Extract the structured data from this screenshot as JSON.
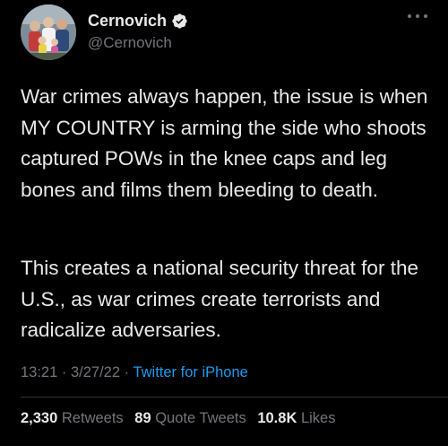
{
  "author": {
    "display_name": "Cernovich",
    "handle": "@Cernovich",
    "verified_icon": "verified-badge-icon",
    "avatar": "profile-photo"
  },
  "tweet": {
    "paragraphs": [
      "War crimes always happen, the issue is when MY COUNTRY is arming the side who shoots captured POWs in the knee caps and leg bones and films them bleeding to death.",
      "This creates a national security threat for the U.S., as war crimes create terrorists and radicalize adversaries."
    ],
    "time": "13:21",
    "separator": "·",
    "date": "3/27/22",
    "source": "Twitter for iPhone"
  },
  "stats": {
    "retweets_count": "2,330",
    "retweets_label": "Retweets",
    "quote_tweets_count": "89",
    "quote_tweets_label": "Quote Tweets",
    "likes_count": "10.8K",
    "likes_label": "Likes"
  },
  "colors": {
    "background": "#000000",
    "text": "#e7e9ea",
    "secondary": "#71767b",
    "accent": "#1d9bf0",
    "divider": "#2f3336"
  },
  "icons": {
    "more": "more-horizontal-icon"
  }
}
